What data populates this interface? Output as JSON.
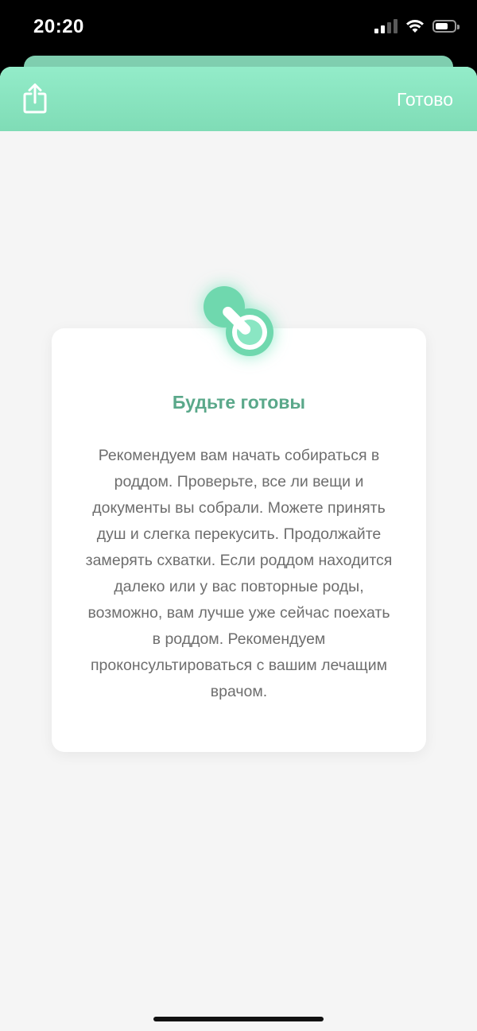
{
  "status_bar": {
    "time": "20:20"
  },
  "header": {
    "share_icon": "share-icon",
    "done_label": "Готово"
  },
  "card": {
    "icon": "pacifier-icon",
    "title": "Будьте готовы",
    "body": "Рекомендуем вам начать собираться в роддом. Проверьте, все ли вещи и документы вы собрали. Можете принять душ и слегка перекусить. Продолжайте замерять схватки. Если роддом находится далеко или у вас повторные роды, возможно, вам лучше уже сейчас поехать в роддом. Рекомендуем проконсультироваться с вашим лечащим врачом."
  },
  "colors": {
    "accent": "#7fdcb6",
    "title": "#5aa88a",
    "background": "#f5f5f5"
  }
}
